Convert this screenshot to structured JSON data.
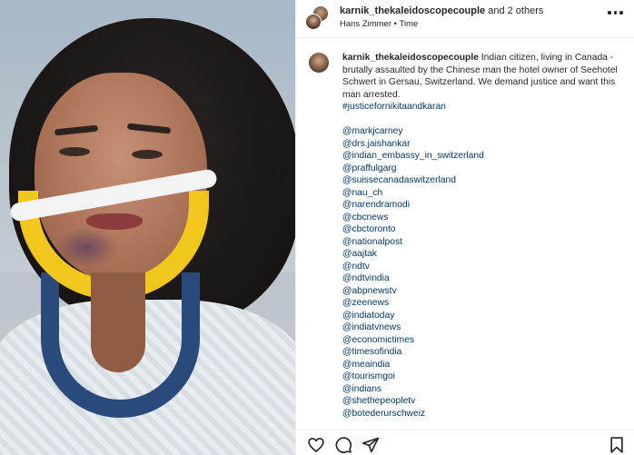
{
  "header": {
    "username": "karnik_thekaleidoscopecouple",
    "collab_suffix": " and 2 others",
    "audio_credit": "Hans Zimmer • Time"
  },
  "caption": {
    "username": "karnik_thekaleidoscopecouple",
    "text": " Indian citizen, living in Canada - brutally assaulted by the Chinese man the hotel owner of Seehotel Schwert in Gersau, Switzerland. We demand justice and want this man arrested.",
    "hashtag": "#justicefornikitaandkaran",
    "mentions": [
      "@markjcarney",
      "@drs.jaishankar",
      "@indian_embassy_in_switzerland",
      "@praffulgarg",
      "@suissecanadaswitzerland",
      "@nau_ch",
      "@narendramodi",
      "@cbcnews",
      "@cbctoronto",
      "@nationalpost",
      "@aajtak",
      "@ndtv",
      "@ndtvindia",
      "@abpnewstv",
      "@zeenews",
      "@indiatoday",
      "@indiatvnews",
      "@economictimes",
      "@timesofindia",
      "@meaindia",
      "@tourismgoi",
      "@indians",
      "@shethepeopletv",
      "@botederurschweiz"
    ]
  },
  "icons": {
    "more": "more-options-icon",
    "like": "heart-icon",
    "comment": "comment-icon",
    "share": "share-icon",
    "save": "bookmark-icon"
  }
}
